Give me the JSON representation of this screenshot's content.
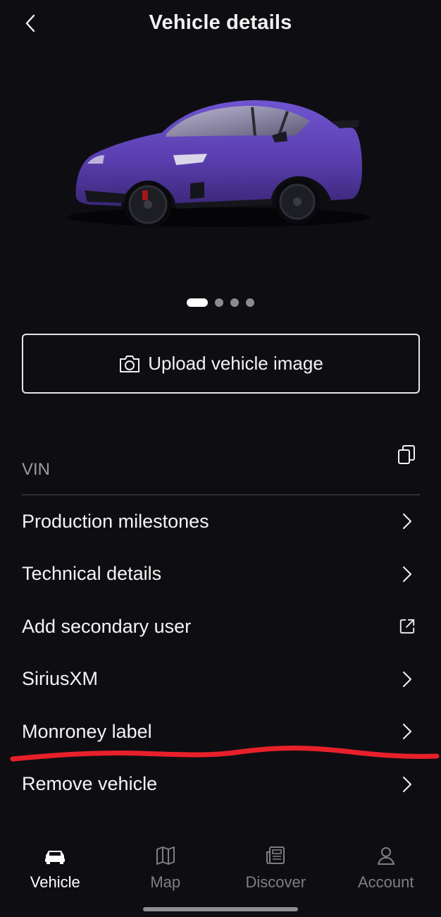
{
  "header": {
    "title": "Vehicle details"
  },
  "carousel": {
    "total": 4,
    "active_index": 0
  },
  "upload": {
    "label": "Upload vehicle image"
  },
  "vin": {
    "label": "VIN"
  },
  "menu": {
    "items": [
      {
        "label": "Production milestones",
        "icon": "chevron-right-icon"
      },
      {
        "label": "Technical details",
        "icon": "chevron-right-icon"
      },
      {
        "label": "Add secondary user",
        "icon": "external-link-icon"
      },
      {
        "label": "SiriusXM",
        "icon": "chevron-right-icon"
      },
      {
        "label": "Monroney label",
        "icon": "chevron-right-icon"
      },
      {
        "label": "Remove vehicle",
        "icon": "chevron-right-icon"
      }
    ]
  },
  "tabs": [
    {
      "label": "Vehicle",
      "icon": "car-icon",
      "active": true
    },
    {
      "label": "Map",
      "icon": "map-icon",
      "active": false
    },
    {
      "label": "Discover",
      "icon": "newspaper-icon",
      "active": false
    },
    {
      "label": "Account",
      "icon": "person-icon",
      "active": false
    }
  ],
  "colors": {
    "background": "#0e0e12",
    "text": "#f2f2f2",
    "muted": "#9a9aa0",
    "car": "#5b3fb0",
    "annotation": "#e8202a"
  }
}
